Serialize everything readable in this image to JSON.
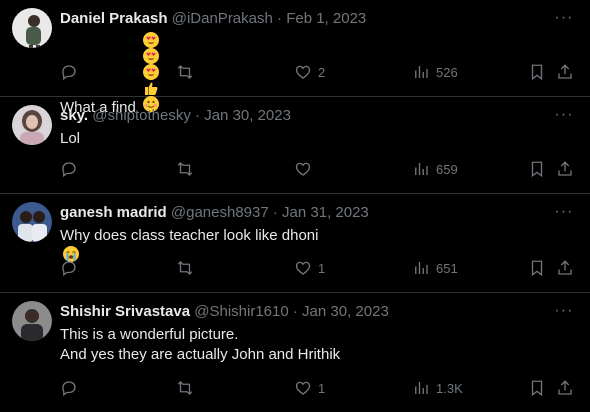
{
  "tweets": [
    {
      "name": "Daniel Prakash",
      "handle": "@iDanPrakash",
      "sep": "·",
      "date": "Feb 1, 2023",
      "lines": [
        "What a find"
      ],
      "emojis": [
        "heart-eyes-emoji",
        "heart-eyes-emoji",
        "heart-eyes-emoji",
        "thumbs-up-emoji",
        "smiling-face-emoji"
      ],
      "replies": "",
      "retweets": "",
      "likes": "2",
      "views": "526"
    },
    {
      "name": "sky.",
      "handle": "@shiptothesky",
      "sep": "·",
      "date": "Jan 30, 2023",
      "lines": [
        "Lol"
      ],
      "replies": "",
      "retweets": "",
      "likes": "",
      "views": "659"
    },
    {
      "name": "ganesh madrid",
      "handle": "@ganesh8937",
      "sep": "·",
      "date": "Jan 31, 2023",
      "lines": [
        "Why does class teacher look like dhoni"
      ],
      "emojis": [
        "crying-face-emoji"
      ],
      "replies": "",
      "retweets": "",
      "likes": "1",
      "views": "651"
    },
    {
      "name": "Shishir Srivastava",
      "handle": "@Shishir1610",
      "sep": "·",
      "date": "Jan 30, 2023",
      "lines": [
        "This is a wonderful picture.",
        "And yes they are actually John and Hrithik"
      ],
      "replies": "",
      "retweets": "",
      "likes": "1",
      "views": "1.3K"
    }
  ],
  "more_label": "···"
}
